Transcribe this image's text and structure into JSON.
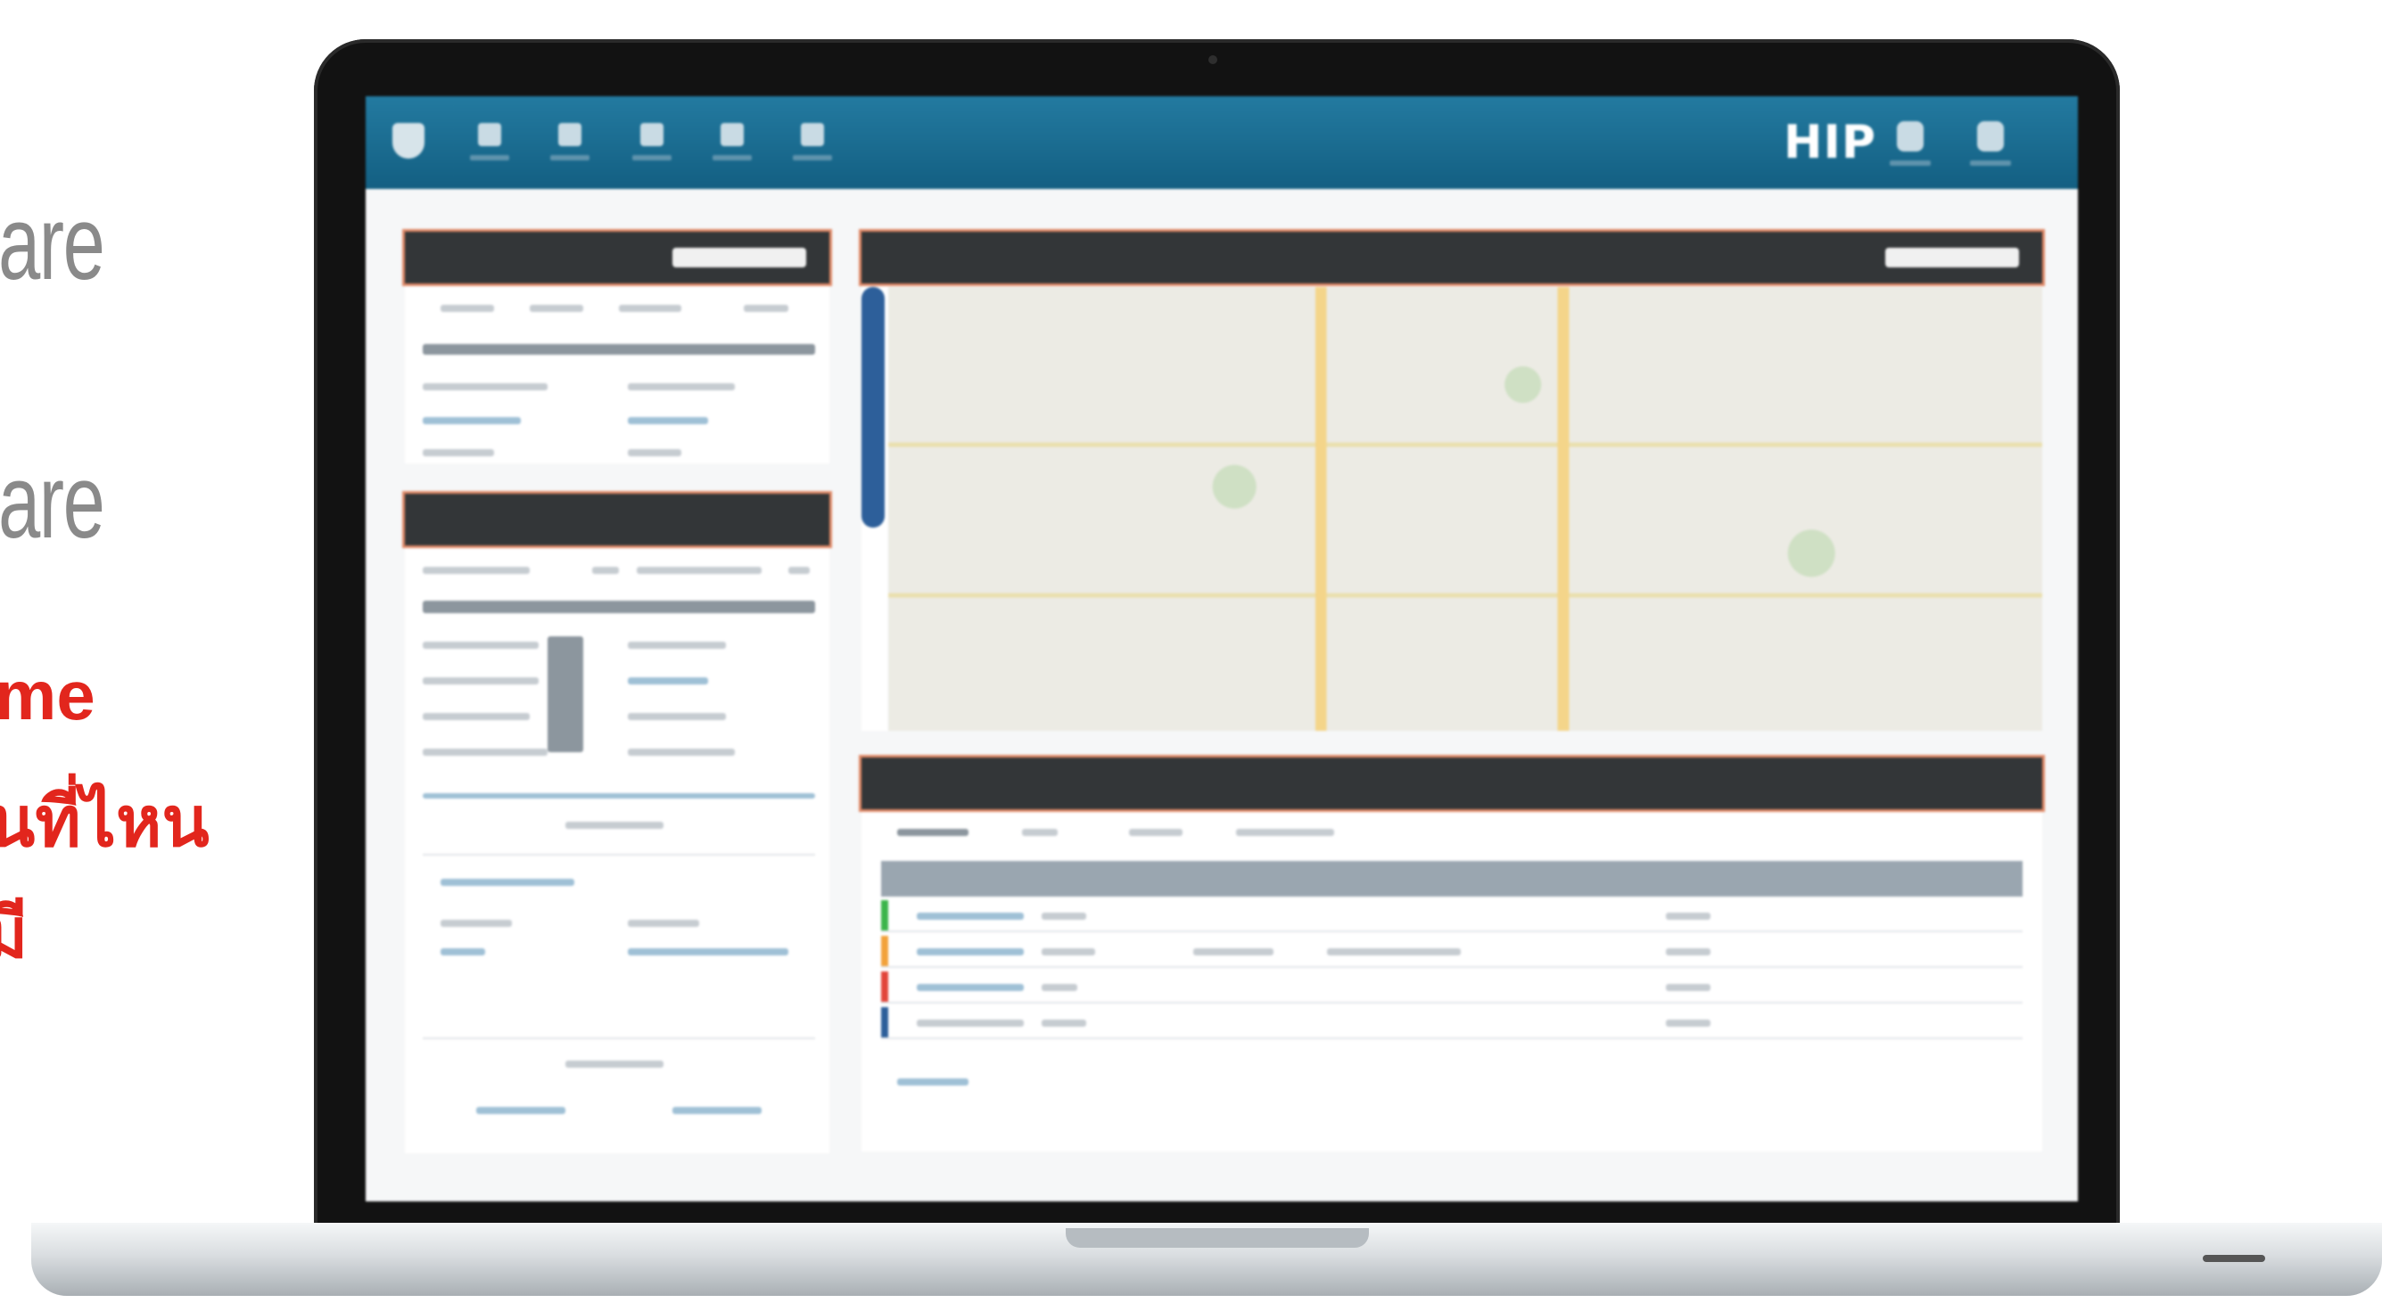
{
  "marketing": {
    "line1": "are",
    "line2": "are",
    "line3": "me",
    "line4": "นที่ไหน",
    "line5": "มี"
  },
  "app": {
    "brand": "HIP"
  },
  "icons": {
    "logo": "shield-logo-icon",
    "nav": [
      "dashboard-icon",
      "person-icon",
      "building-icon",
      "report-icon",
      "settings-icon"
    ],
    "right": [
      "bell-icon",
      "device-icon"
    ]
  },
  "colors": {
    "topbar": "#1b6d92",
    "panel_header": "#333638",
    "marketing_red": "#e2261d"
  }
}
